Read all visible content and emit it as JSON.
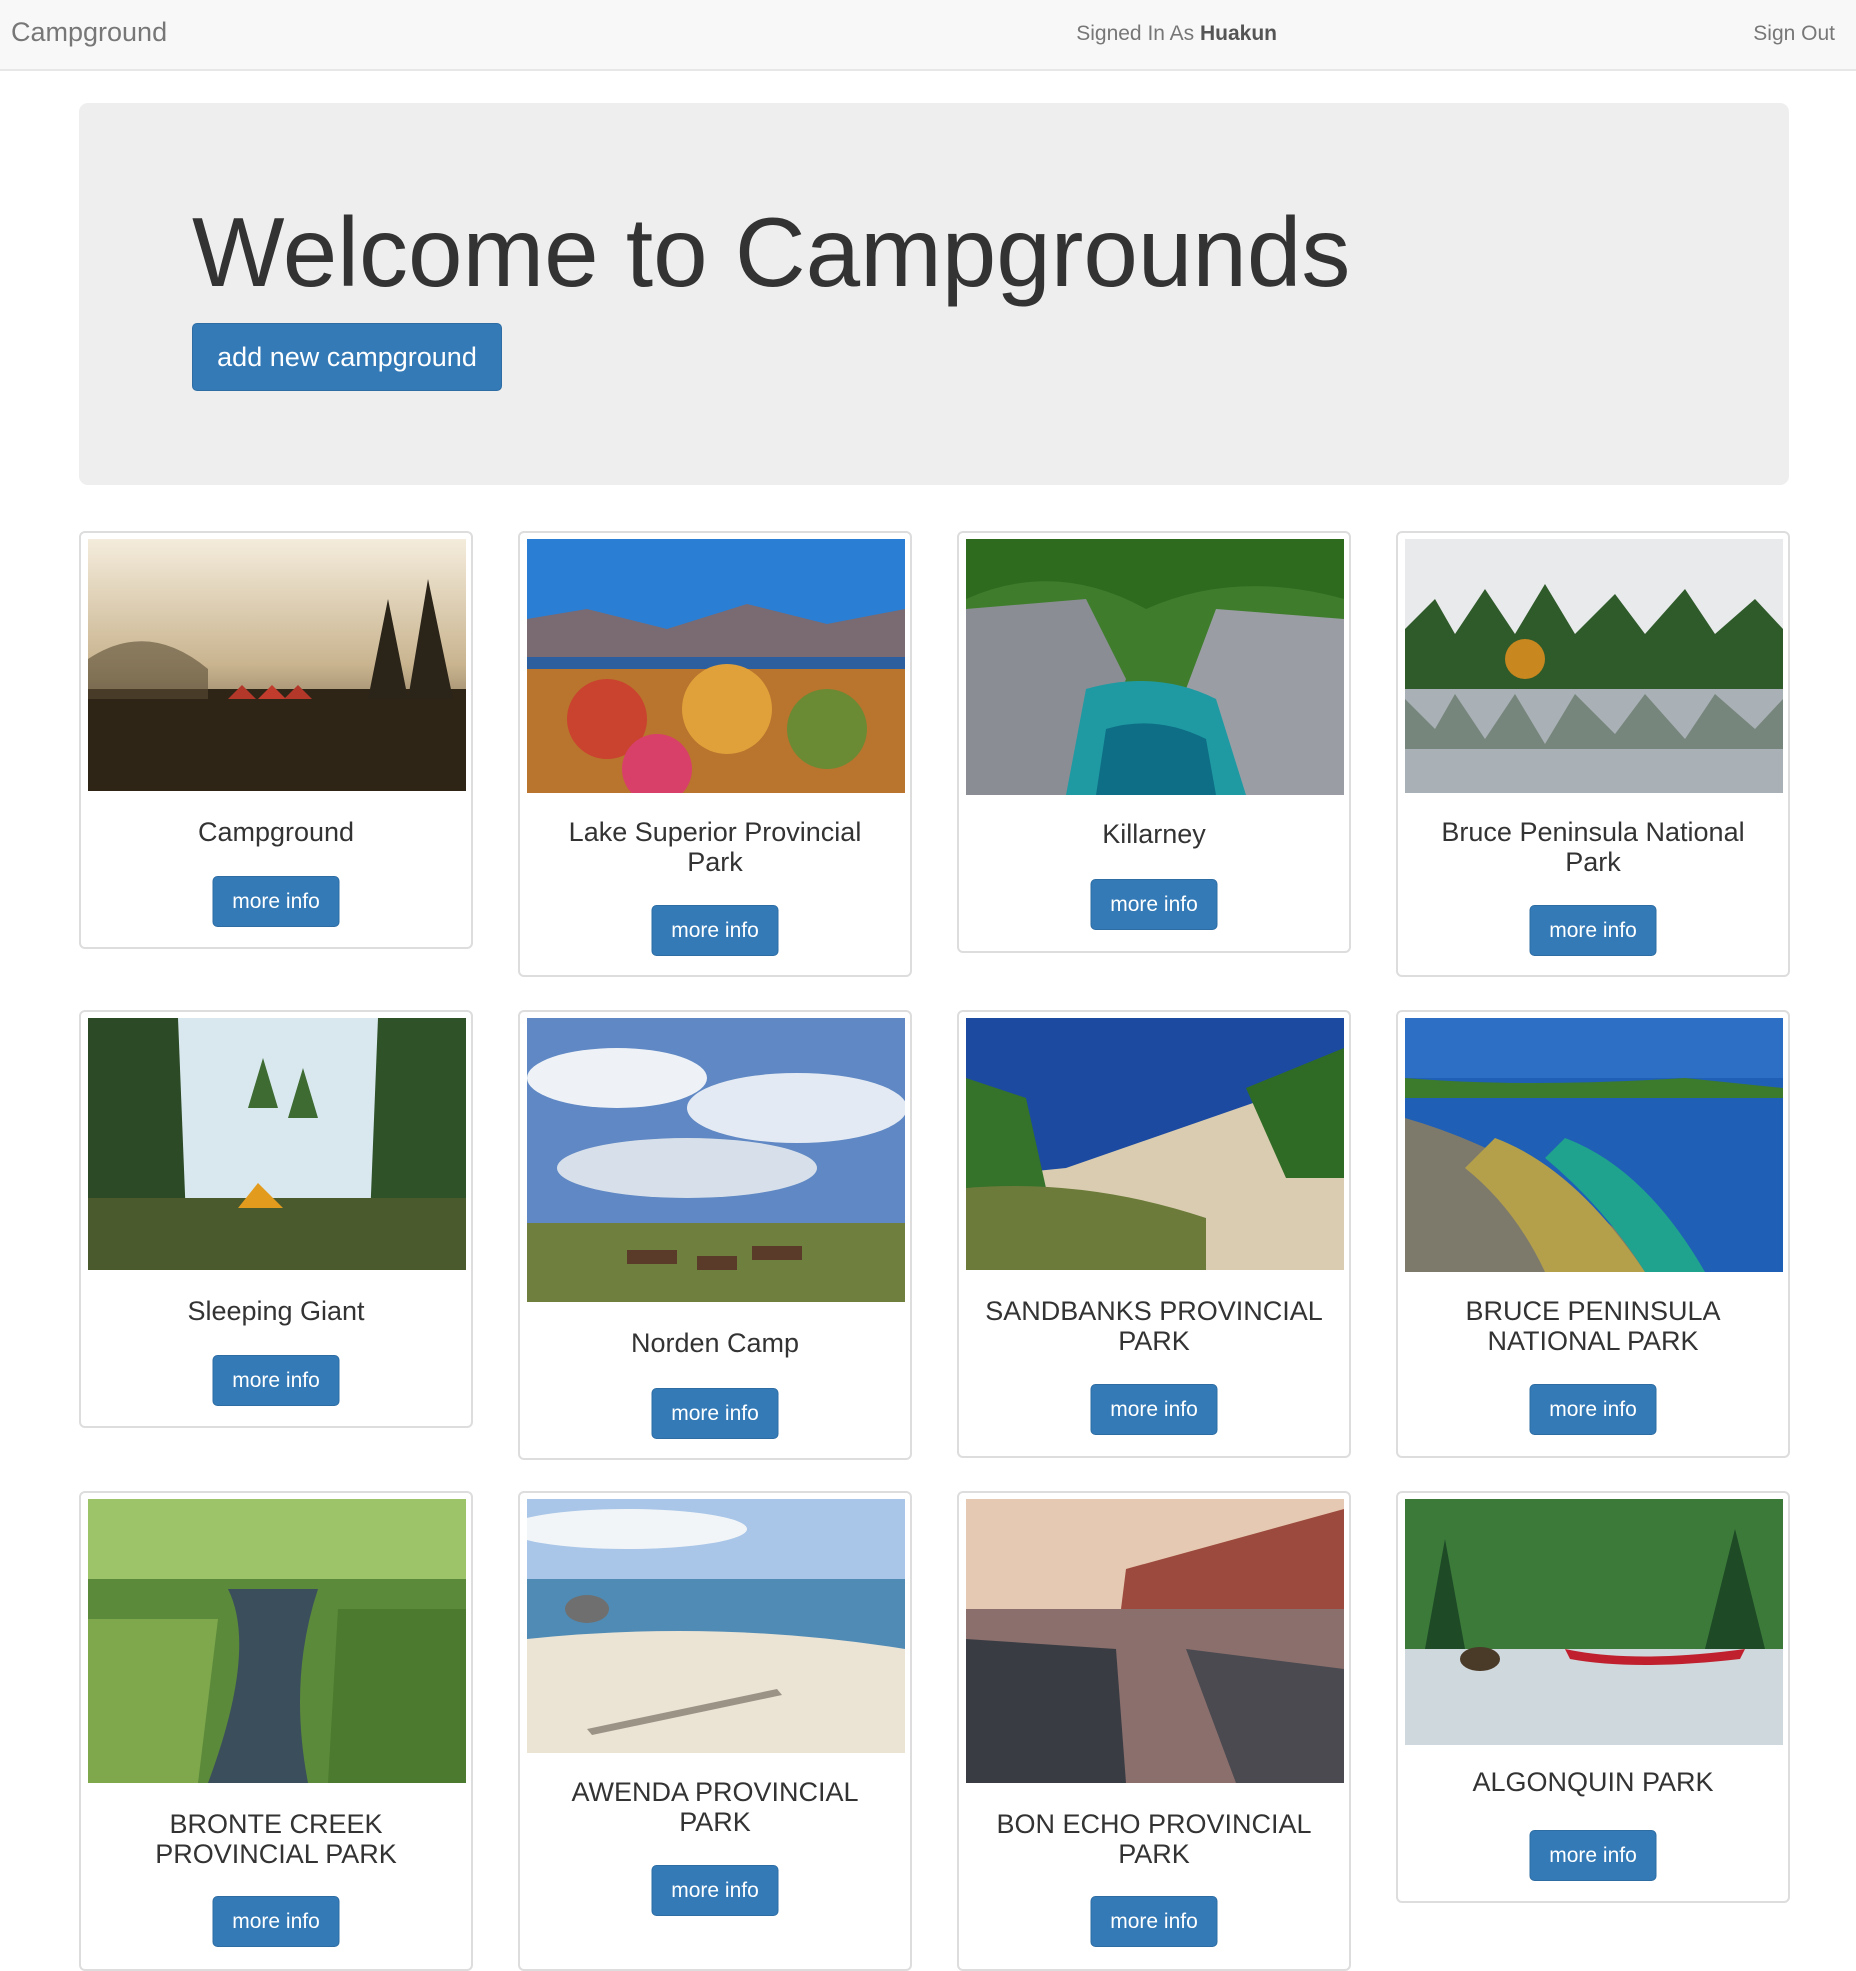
{
  "nav": {
    "brand": "Campground",
    "signed_prefix": "Signed In As ",
    "username": "Huakun",
    "signout": "Sign Out"
  },
  "jumbotron": {
    "title": "Welcome to Campgrounds",
    "add_button": "add new campground"
  },
  "cards": [
    {
      "title": "Campground",
      "button": "more info"
    },
    {
      "title": "Lake Superior Provincial Park",
      "button": "more info"
    },
    {
      "title": "Killarney",
      "button": "more info"
    },
    {
      "title": "Bruce Peninsula National Park",
      "button": "more info"
    },
    {
      "title": "Sleeping Giant",
      "button": "more info"
    },
    {
      "title": "Norden Camp",
      "button": "more info"
    },
    {
      "title": "SANDBANKS PROVINCIAL PARK",
      "button": "more info"
    },
    {
      "title": "BRUCE PENINSULA NATIONAL PARK",
      "button": "more info"
    },
    {
      "title": "BRONTE CREEK PROVINCIAL PARK",
      "button": "more info"
    },
    {
      "title": "AWENDA PROVINCIAL PARK",
      "button": "more info"
    },
    {
      "title": "BON ECHO PROVINCIAL PARK",
      "button": "more info"
    },
    {
      "title": "ALGONQUIN PARK",
      "button": "more info"
    }
  ],
  "colors": {
    "primary": "#337ab7",
    "navbar_bg": "#f8f8f8",
    "jumbotron_bg": "#eeeeee"
  }
}
